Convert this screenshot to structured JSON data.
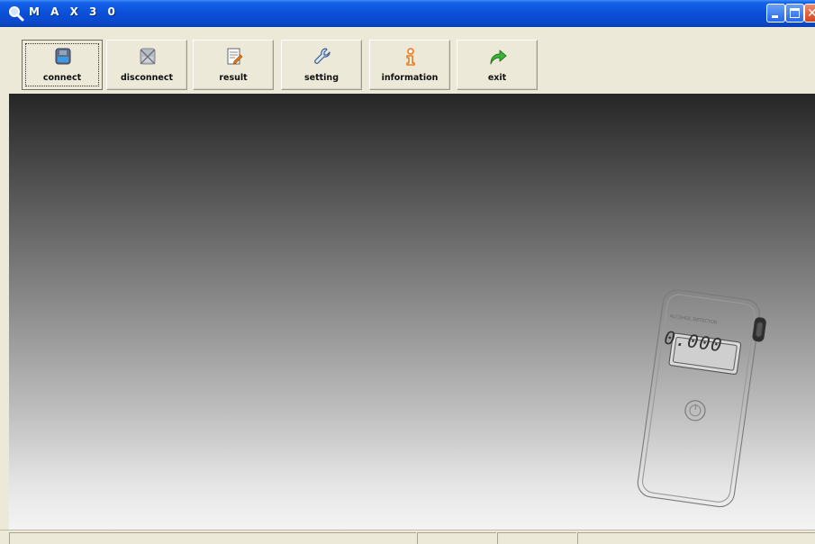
{
  "window": {
    "title": "M A X 3 0"
  },
  "toolbar": {
    "buttons": [
      {
        "label": "connect",
        "icon": "connect-icon",
        "active": true
      },
      {
        "label": "disconnect",
        "icon": "disconnect-icon",
        "active": false
      },
      {
        "label": "result",
        "icon": "result-icon",
        "active": false
      },
      {
        "label": "setting",
        "icon": "wrench-icon",
        "active": false
      },
      {
        "label": "information",
        "icon": "information-icon",
        "active": false
      },
      {
        "label": "exit",
        "icon": "exit-arrow-icon",
        "active": false
      }
    ]
  },
  "device": {
    "header": "ALCOHOL DETECTOR",
    "reading": "0.000"
  },
  "colors": {
    "titlebar": "#0a4fd8",
    "exit_icon": "#3cb33c",
    "info_icon": "#f07818",
    "result_icon": "#e07a1a"
  }
}
